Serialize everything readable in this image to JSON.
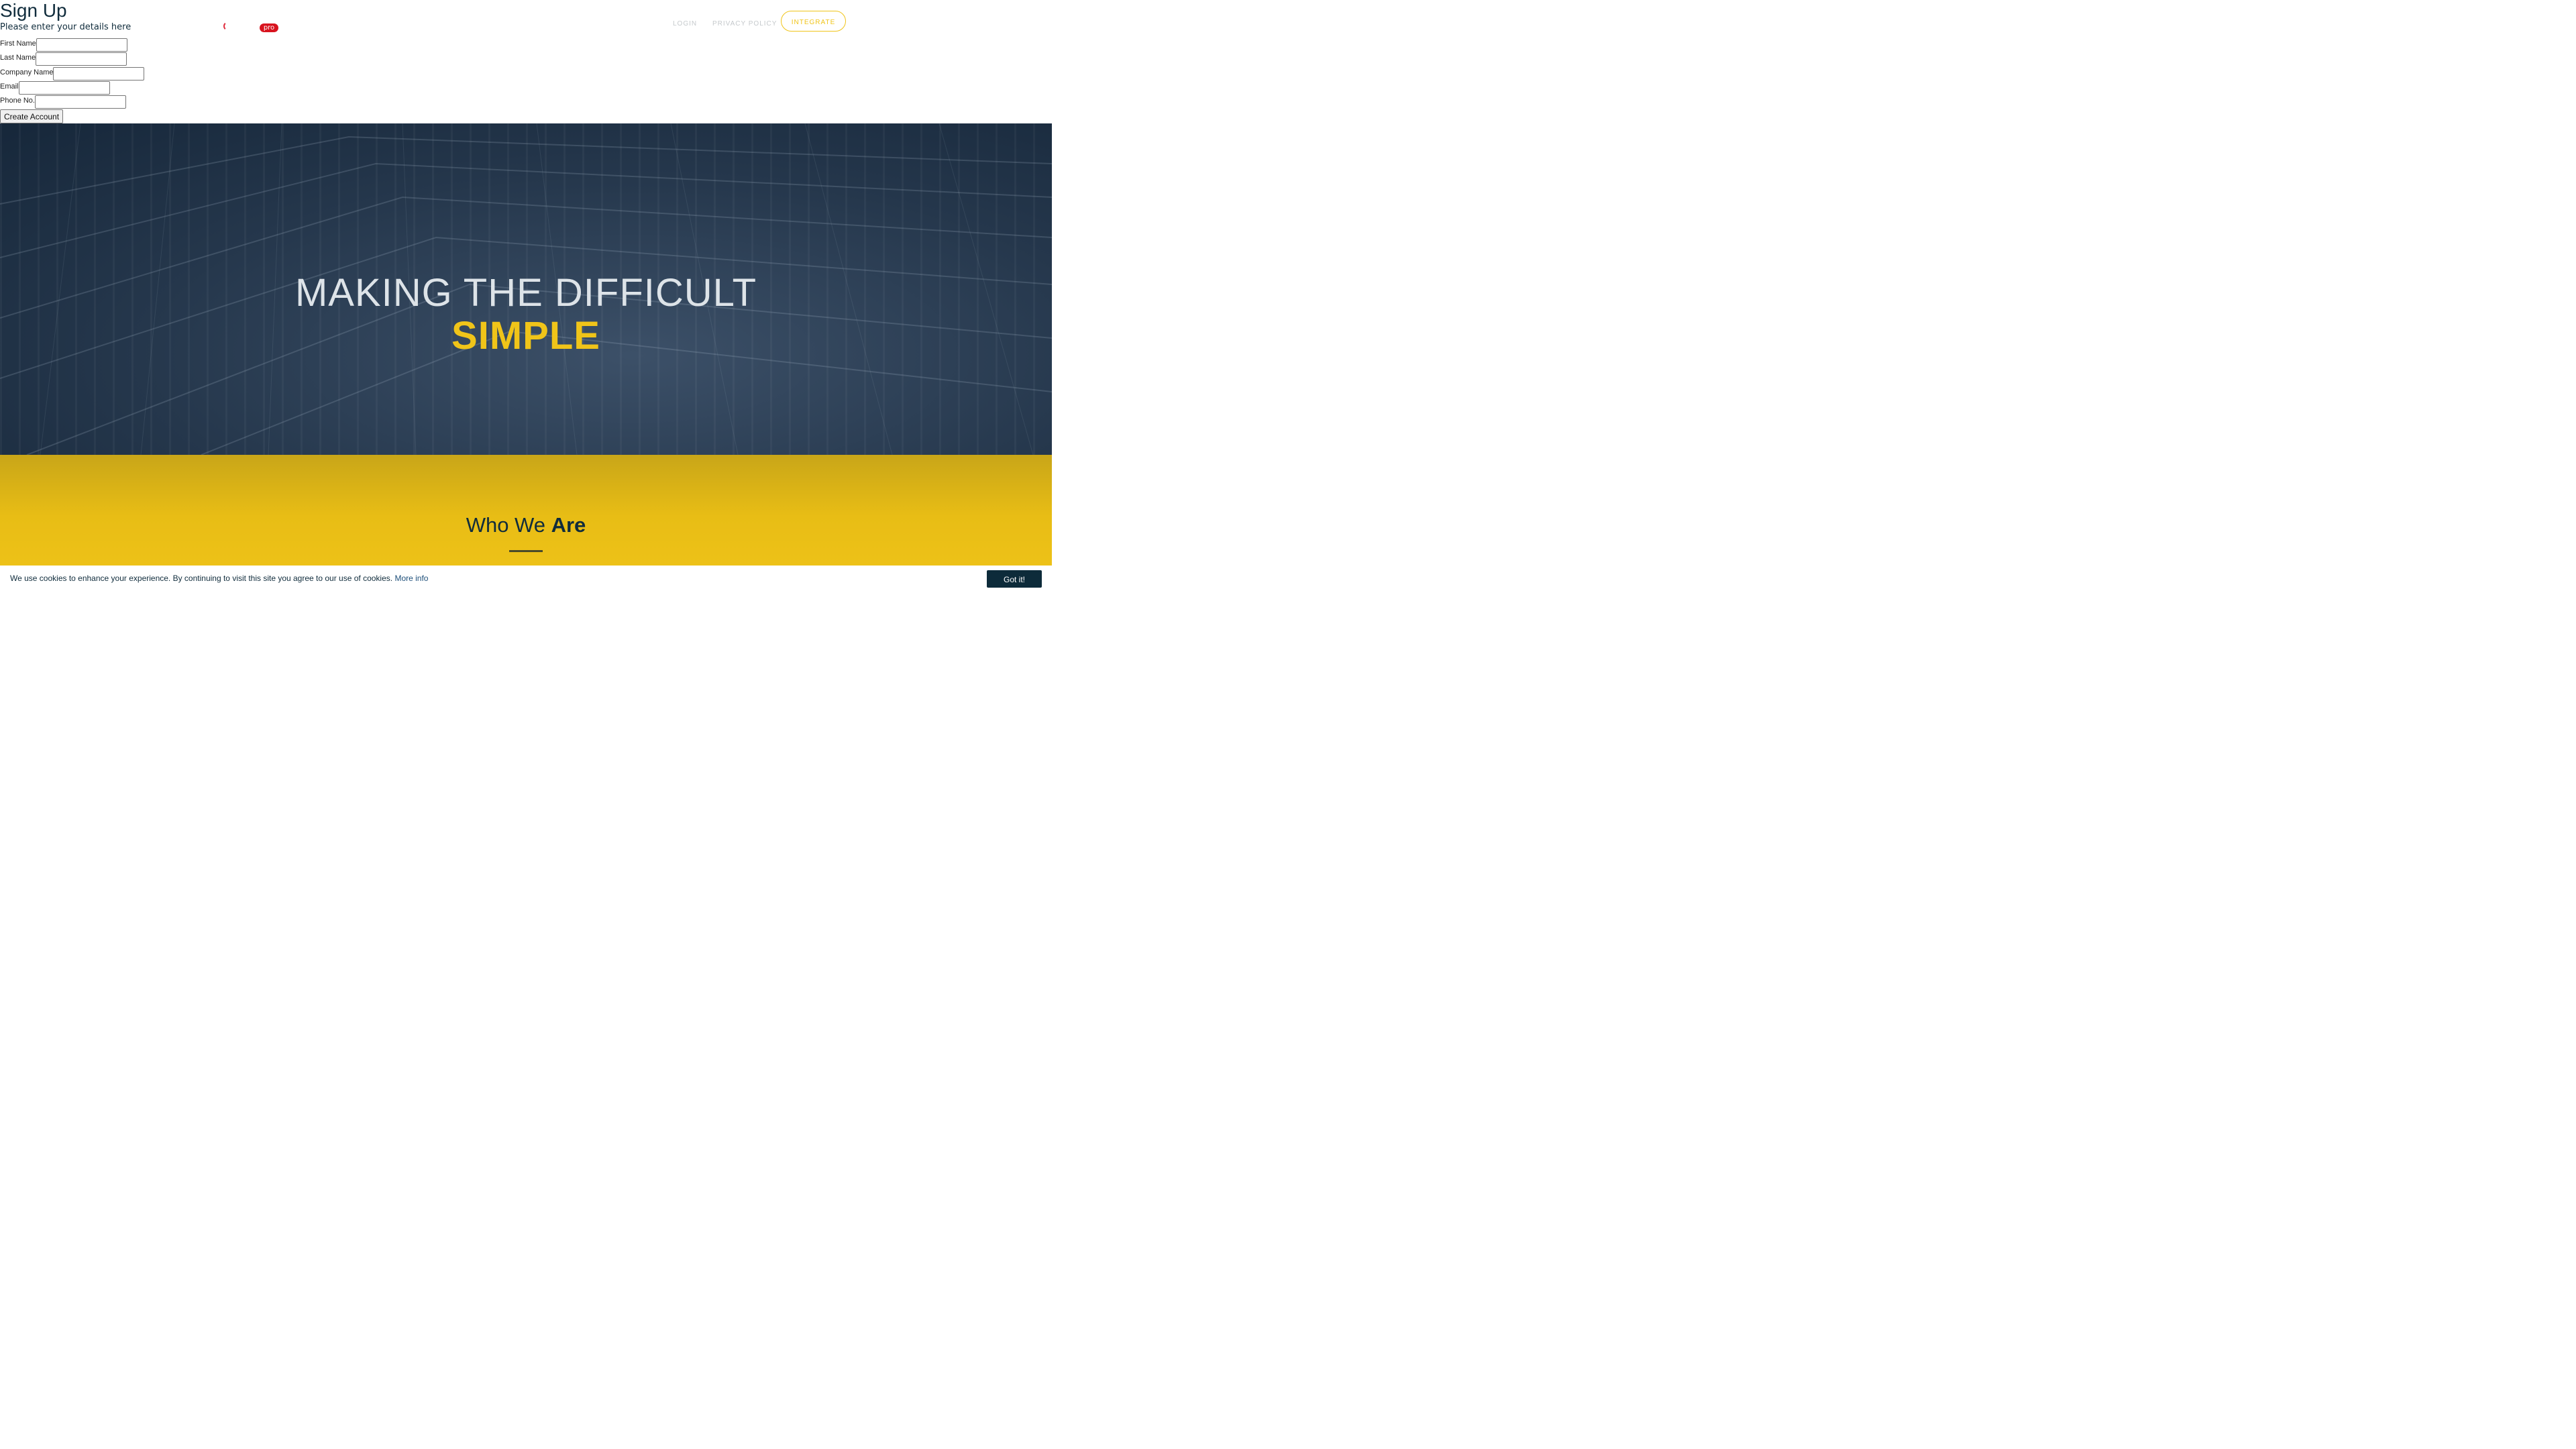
{
  "signup": {
    "title": "Sign Up",
    "subtitle": "Please enter your details here",
    "fields": [
      {
        "label": "First Name",
        "value": ""
      },
      {
        "label": "Last Name",
        "value": ""
      },
      {
        "label": "Company Name",
        "value": ""
      },
      {
        "label": "Email",
        "value": ""
      },
      {
        "label": "Phone No.",
        "value": ""
      }
    ],
    "submit_label": "Create Account"
  },
  "logo": {
    "badge": "pro",
    "badge_color": "#d8141f"
  },
  "nav": {
    "login": "LOGIN",
    "privacy": "PRIVACY POLICY",
    "integrate": "INTEGRATE"
  },
  "hero": {
    "line1": "MAKING THE DIFFICULT",
    "line2": "SIMPLE",
    "accent_color": "#f0c419"
  },
  "about": {
    "title_regular": "Who We",
    "title_bold": "Are"
  },
  "cookie": {
    "text": "We use cookies to enhance your experience. By continuing to visit this site you agree to our use of cookies.",
    "link": "More info",
    "button": "Got it!"
  }
}
